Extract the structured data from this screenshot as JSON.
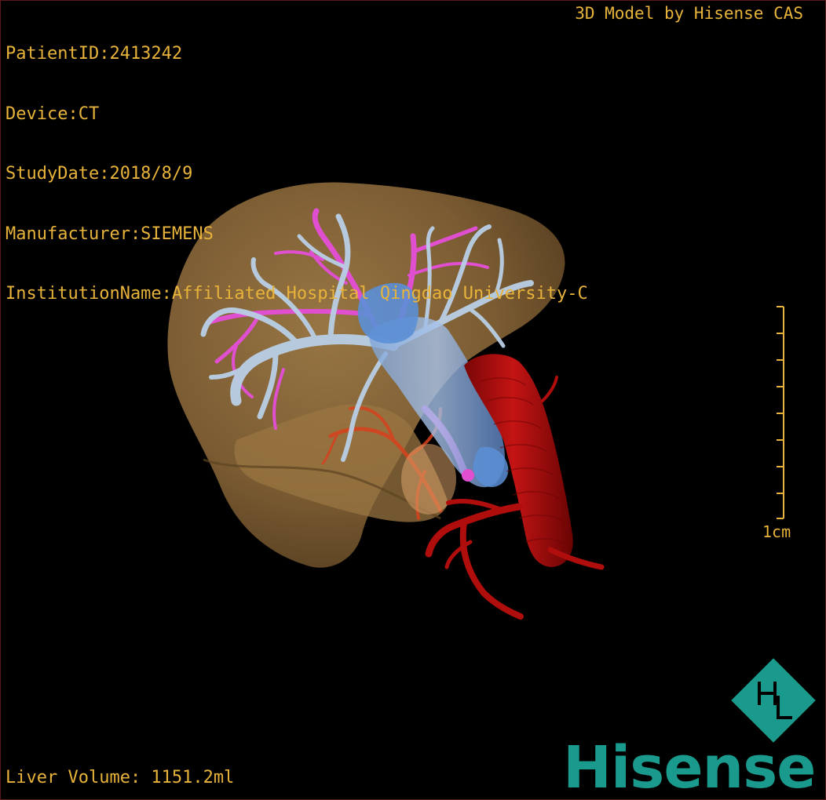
{
  "study": {
    "patient_line": "PatientID:2413242",
    "device_line": "Device:CT",
    "date_line": "StudyDate:2018/8/9",
    "manufacturer_line": "Manufacturer:SIEMENS",
    "institution_line": "InstitutionName:Affiliated Hospital Qingdao University-C"
  },
  "vendor": {
    "label": "3D Model by Hisense CAS"
  },
  "measurement": {
    "volume_line": "Liver Volume: 1151.2ml"
  },
  "scale": {
    "label": "1cm"
  },
  "brand": {
    "name": "Hisense",
    "monogram": "HL",
    "color": "#1a9a8d"
  },
  "colors": {
    "overlay_text": "#e8b33a",
    "liver": "#8a6a3c",
    "portal_vein": "#b9cfe6",
    "hepatic_vein": "#e04fd0",
    "ivc": "#5b8fd6",
    "aorta": "#b00d0d",
    "hepatic_artery": "#d8421e"
  }
}
